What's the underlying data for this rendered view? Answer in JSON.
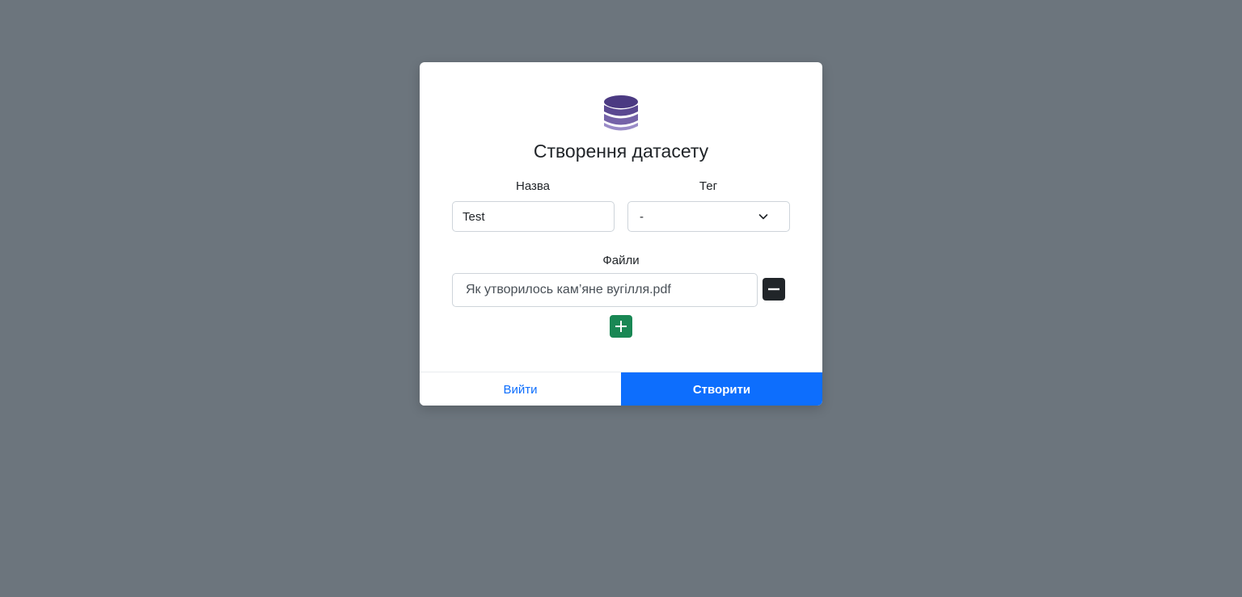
{
  "modal": {
    "title": "Створення датасету",
    "icon": "database-icon",
    "icon_color": "#4b3a82"
  },
  "form": {
    "name_label": "Назва",
    "name_value": "Test",
    "tag_label": "Тег",
    "tag_selected": "-",
    "files_label": "Файли",
    "files": [
      {
        "name": "Як утворилось кам’яне вугілля.pdf"
      }
    ]
  },
  "actions": {
    "exit_label": "Вийти",
    "create_label": "Створити"
  },
  "colors": {
    "backdrop": "#6c757d",
    "primary": "#0d6efd",
    "success": "#198754",
    "dark": "#212529"
  }
}
